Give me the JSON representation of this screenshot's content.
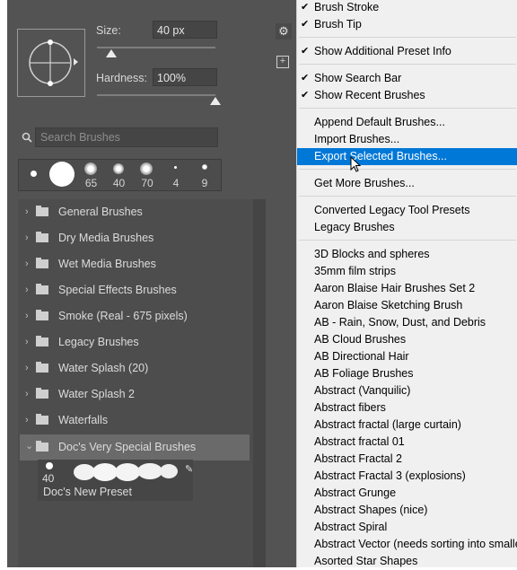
{
  "brush_panel": {
    "size_label": "Size:",
    "size_value": "40 px",
    "hardness_label": "Hardness:",
    "hardness_value": "100%",
    "size_slider_pct": 12,
    "hardness_slider_pct": 100,
    "search_placeholder": "Search Brushes",
    "recent_brushes": [
      {
        "size": ""
      },
      {
        "size": ""
      },
      {
        "size": "65"
      },
      {
        "size": "40"
      },
      {
        "size": "70"
      },
      {
        "size": "4"
      },
      {
        "size": "9"
      }
    ],
    "folders": [
      "General Brushes",
      "Dry Media Brushes",
      "Wet Media Brushes",
      "Special Effects Brushes",
      "Smoke (Real - 675 pixels)",
      "Legacy Brushes",
      "Water Splash (20)",
      "Water Splash 2",
      "Waterfalls",
      "Doc's Very Special Brushes"
    ],
    "preset": {
      "size": "40",
      "name": "Doc's New Preset"
    }
  },
  "menu": {
    "items": [
      {
        "label": "Brush Stroke",
        "checked": "✔"
      },
      {
        "label": "Brush Tip",
        "checked": "✔"
      },
      {
        "label": "Show Additional Preset Info",
        "checked": "✔"
      },
      {
        "label": "Show Search Bar",
        "checked": "✔"
      },
      {
        "label": "Show Recent Brushes",
        "checked": "✔"
      },
      {
        "label": "Append Default Brushes...",
        "checked": ""
      },
      {
        "label": "Import Brushes...",
        "checked": ""
      },
      {
        "label": "Export Selected Brushes...",
        "checked": ""
      },
      {
        "label": "Get More Brushes...",
        "checked": ""
      },
      {
        "label": "Converted Legacy Tool Presets",
        "checked": ""
      },
      {
        "label": "Legacy Brushes",
        "checked": ""
      },
      {
        "label": "3D Blocks and spheres",
        "checked": ""
      },
      {
        "label": "35mm film strips",
        "checked": ""
      },
      {
        "label": "Aaron Blaise Hair Brushes Set 2",
        "checked": ""
      },
      {
        "label": "Aaron Blaise Sketching Brush",
        "checked": ""
      },
      {
        "label": "AB - Rain, Snow, Dust, and Debris",
        "checked": ""
      },
      {
        "label": "AB Cloud Brushes",
        "checked": ""
      },
      {
        "label": "AB Directional Hair",
        "checked": ""
      },
      {
        "label": "AB Foliage Brushes",
        "checked": ""
      },
      {
        "label": "Abstract (Vanquilic)",
        "checked": ""
      },
      {
        "label": "Abstract fibers",
        "checked": ""
      },
      {
        "label": "Abstract fractal (large curtain)",
        "checked": ""
      },
      {
        "label": "Abstract fractal 01",
        "checked": ""
      },
      {
        "label": "Abstract Fractal 2",
        "checked": ""
      },
      {
        "label": "Abstract Fractal 3 (explosions)",
        "checked": ""
      },
      {
        "label": "Abstract Grunge",
        "checked": ""
      },
      {
        "label": "Abstract Shapes (nice)",
        "checked": ""
      },
      {
        "label": "Abstract Spiral",
        "checked": ""
      },
      {
        "label": "Abstract Vector (needs sorting into smaller",
        "checked": ""
      },
      {
        "label": "Asorted Star Shapes",
        "checked": ""
      }
    ],
    "highlighted": "Export Selected Brushes...",
    "colors": {
      "highlight": "#0078d7",
      "panel": "#535353"
    }
  }
}
